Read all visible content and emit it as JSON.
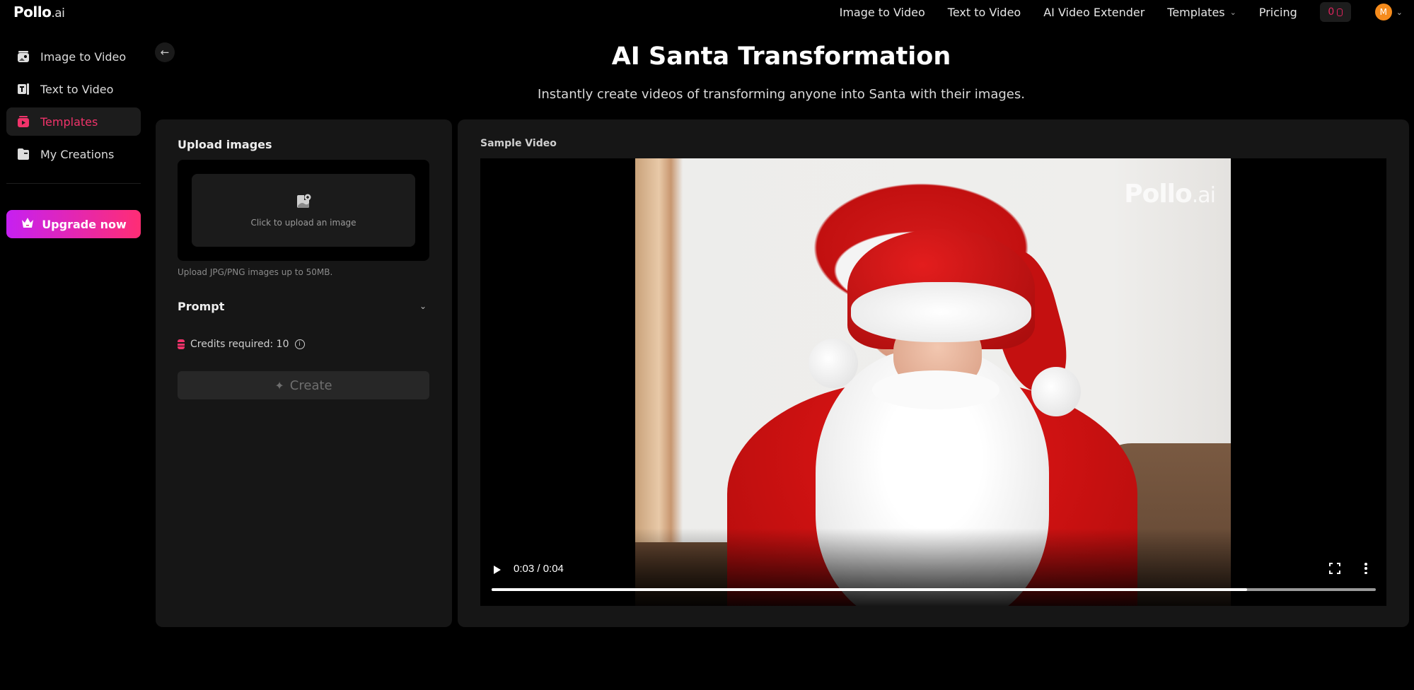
{
  "brand": {
    "name": "Pollo",
    "suffix": ".ai"
  },
  "topnav": {
    "links": [
      {
        "label": "Image to Video"
      },
      {
        "label": "Text to Video"
      },
      {
        "label": "AI Video Extender"
      },
      {
        "label": "Templates",
        "has_dropdown": true
      },
      {
        "label": "Pricing"
      }
    ],
    "credits_count": "0",
    "avatar_initial": "M"
  },
  "sidebar": {
    "items": [
      {
        "label": "Image to Video",
        "icon": "image-video-icon",
        "active": false
      },
      {
        "label": "Text to Video",
        "icon": "text-video-icon",
        "active": false
      },
      {
        "label": "Templates",
        "icon": "templates-icon",
        "active": true
      },
      {
        "label": "My Creations",
        "icon": "folder-icon",
        "active": false
      }
    ],
    "upgrade_label": "Upgrade now"
  },
  "header": {
    "title": "AI Santa Transformation",
    "subtitle": "Instantly create videos of transforming anyone into Santa with their images."
  },
  "form": {
    "upload_heading": "Upload images",
    "upload_cta": "Click to upload an image",
    "upload_hint": "Upload JPG/PNG images up to 50MB.",
    "prompt_label": "Prompt",
    "credits_label": "Credits required: 10",
    "create_label": "Create"
  },
  "sample": {
    "label": "Sample Video",
    "watermark": "Pollo",
    "watermark_suffix": ".ai",
    "time_display": "0:03 / 0:04",
    "progress": 0.854
  },
  "colors": {
    "accent": "#f0336a",
    "upgrade_gradient_start": "#c620f2",
    "upgrade_gradient_end": "#ff2d74",
    "avatar": "#f58b1c",
    "panel_bg": "#161616"
  }
}
